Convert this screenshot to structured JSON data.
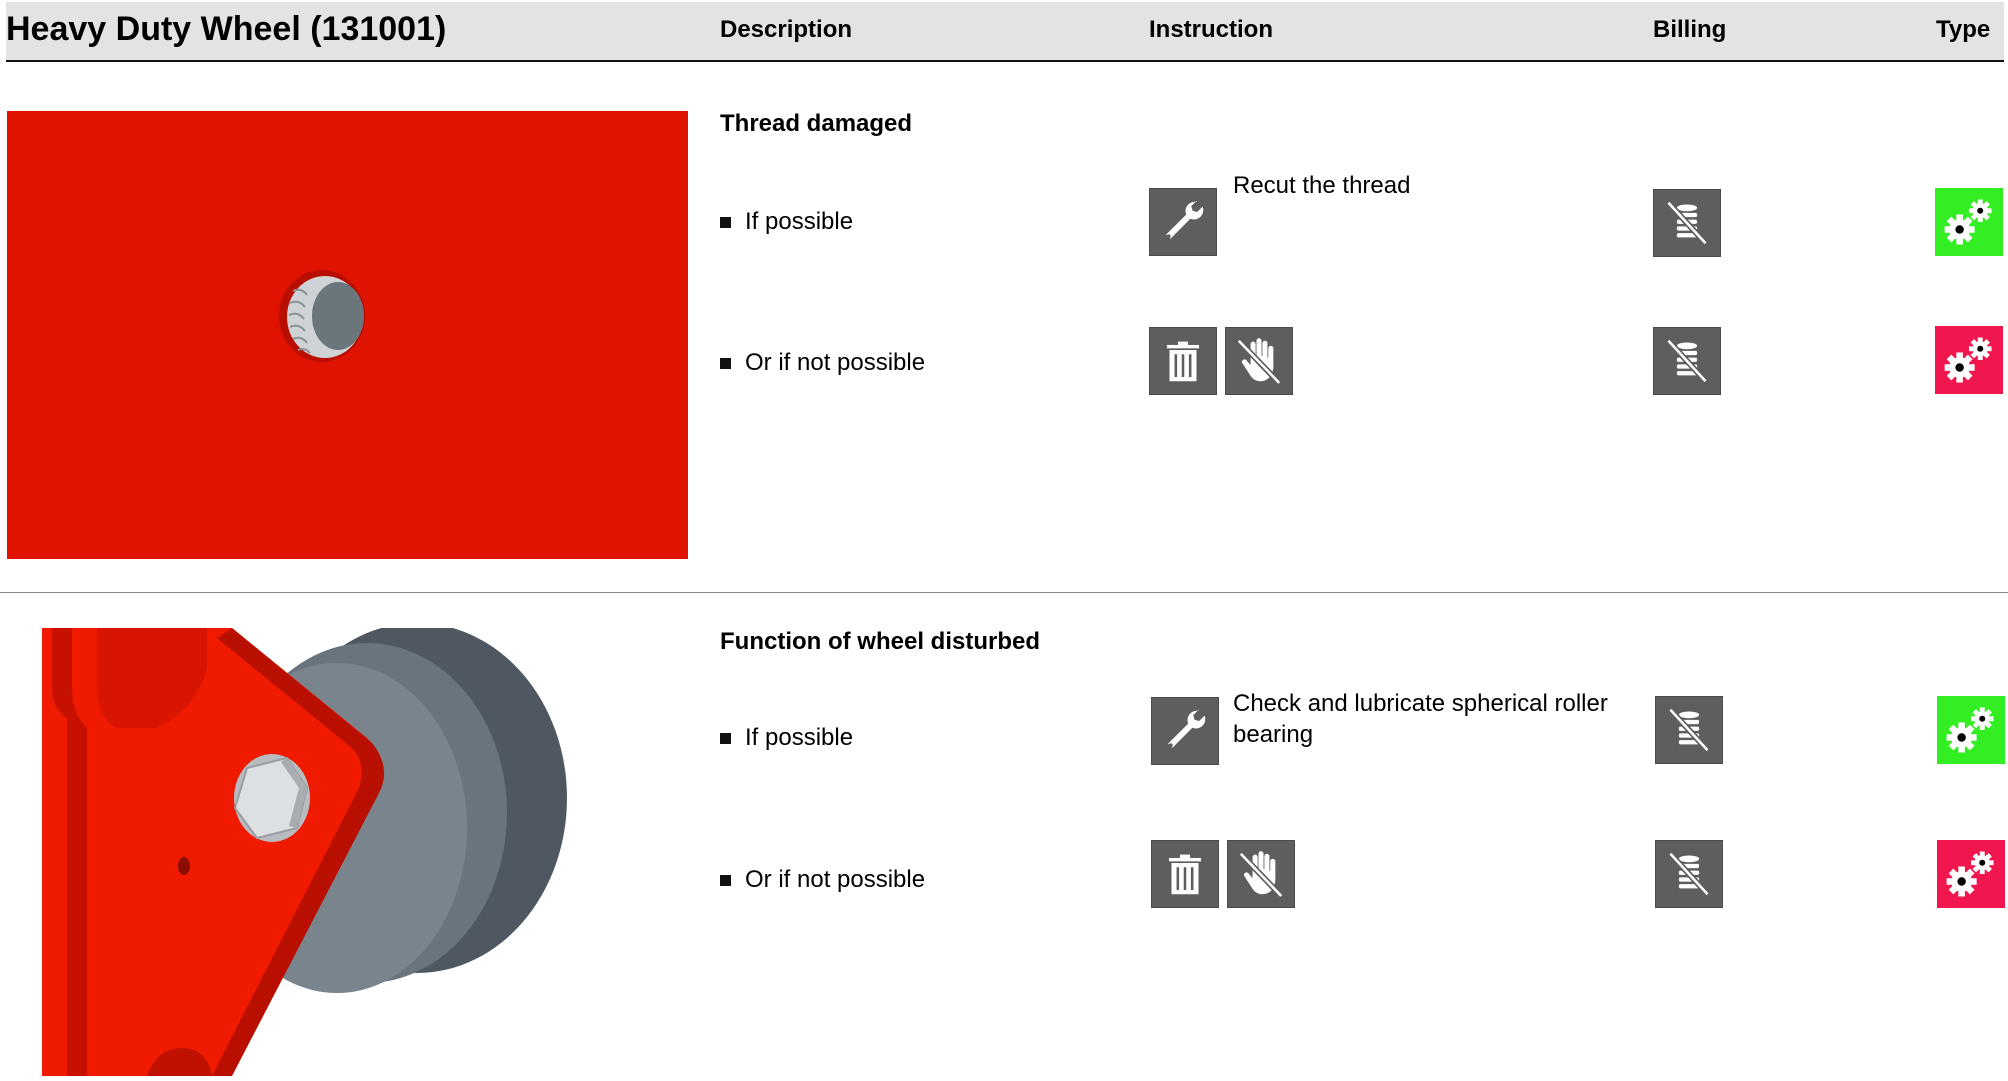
{
  "header": {
    "title": "Heavy Duty Wheel (131001)",
    "col_description": "Description",
    "col_instruction": "Instruction",
    "col_billing": "Billing",
    "col_type": "Type"
  },
  "sections": [
    {
      "title": "Thread damaged",
      "options": [
        {
          "label": "If possible",
          "instruction_icons": [
            "wrench-icon"
          ],
          "instruction_text": "Recut the thread",
          "billing_icon": "no-billing-coins-icon",
          "type_icon": "gears-icon",
          "type_color": "#33ee22"
        },
        {
          "label": "Or if not possible",
          "instruction_icons": [
            "trash-icon",
            "no-touch-hand-icon"
          ],
          "instruction_text": "",
          "billing_icon": "no-billing-coins-icon",
          "type_icon": "gears-icon",
          "type_color": "#f2164e"
        }
      ]
    },
    {
      "title": "Function of wheel disturbed",
      "options": [
        {
          "label": "If possible",
          "instruction_icons": [
            "wrench-icon"
          ],
          "instruction_text": "Check and lubricate spherical roller bearing",
          "billing_icon": "no-billing-coins-icon",
          "type_icon": "gears-icon",
          "type_color": "#33ee22"
        },
        {
          "label": "Or if not possible",
          "instruction_icons": [
            "trash-icon",
            "no-touch-hand-icon"
          ],
          "instruction_text": "",
          "billing_icon": "no-billing-coins-icon",
          "type_icon": "gears-icon",
          "type_color": "#f2164e"
        }
      ]
    }
  ],
  "colors": {
    "header_bg": "#e3e3e3",
    "tile_bg": "#5e5e5e",
    "part_red": "#e01200",
    "wheel_grey": "#5c6670"
  }
}
